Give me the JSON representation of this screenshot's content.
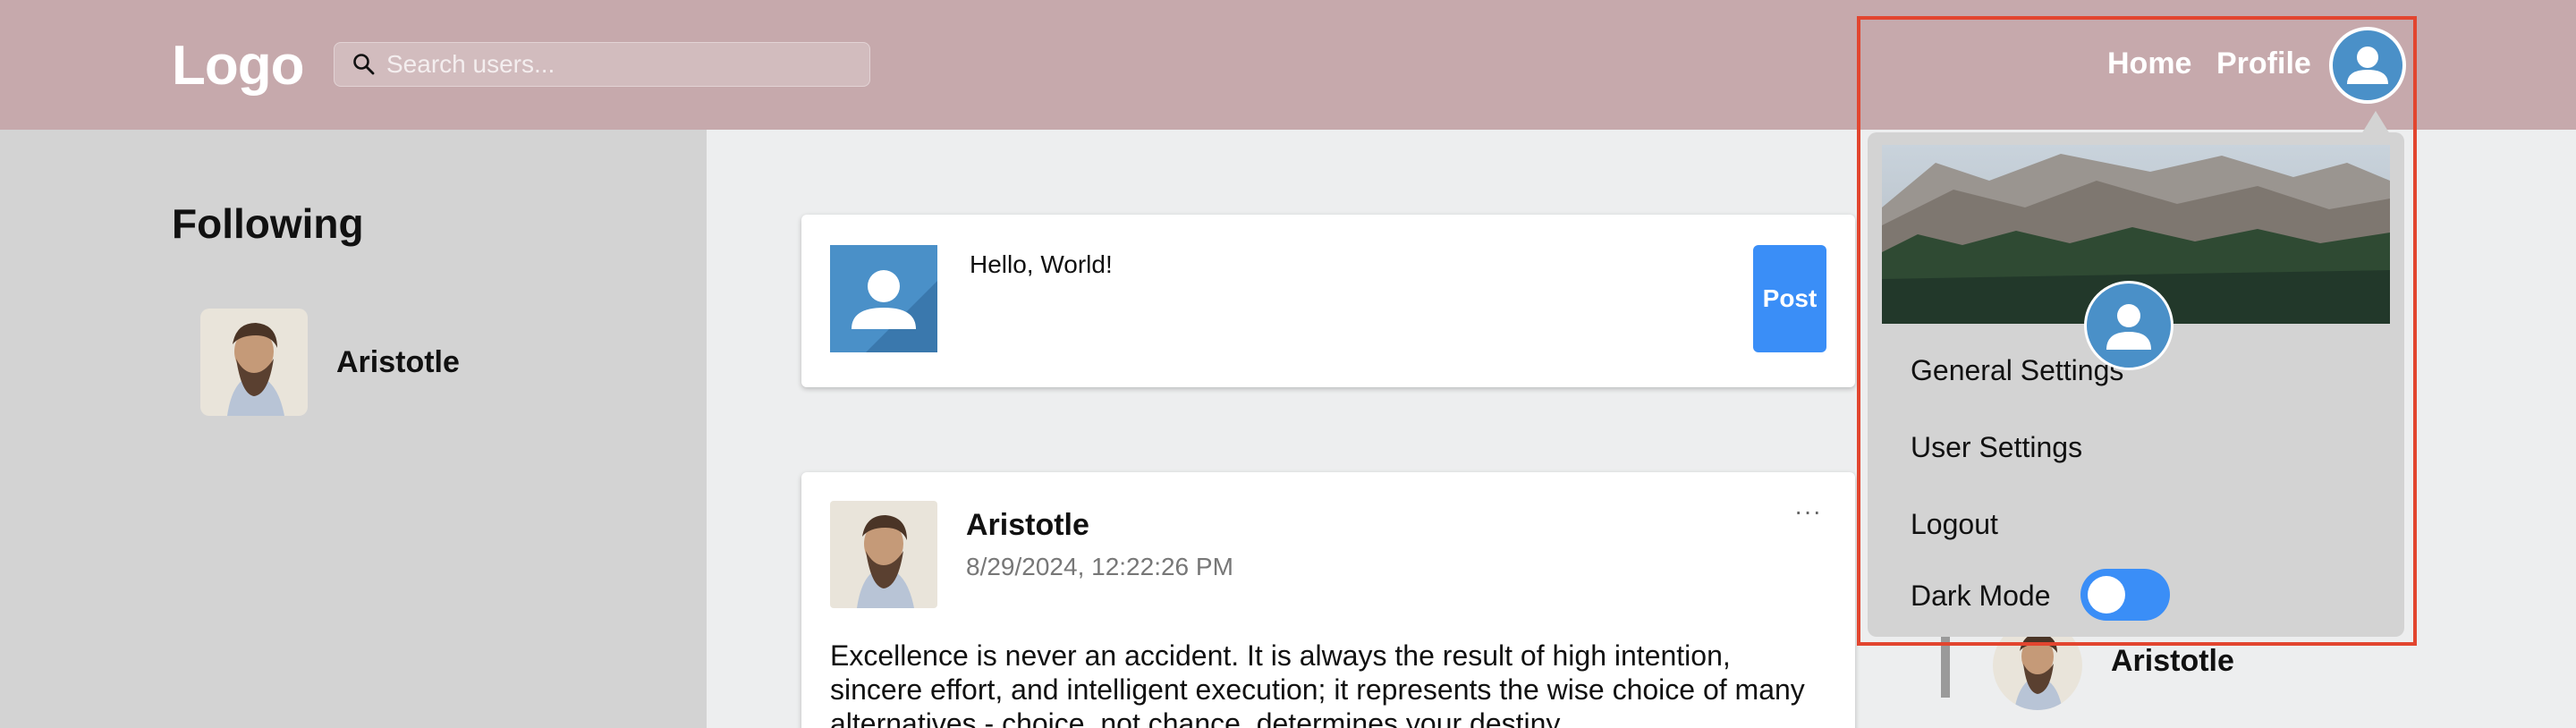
{
  "header": {
    "logo": "Logo",
    "search_placeholder": "Search users...",
    "nav": {
      "home": "Home",
      "profile": "Profile"
    }
  },
  "sidebar": {
    "title": "Following",
    "items": [
      {
        "name": "Aristotle"
      }
    ]
  },
  "composer": {
    "text": "Hello, World!",
    "post_label": "Post"
  },
  "post": {
    "author": "Aristotle",
    "timestamp": "8/29/2024, 12:22:26 PM",
    "menu": "···",
    "body": "Excellence is never an accident. It is always the result of high intention, sincere effort, and intelligent execution; it represents the wise choice of many alternatives - choice, not chance, determines your destiny."
  },
  "right_panel": {
    "name": "Aristotle"
  },
  "dropdown": {
    "items": {
      "general_settings": "General Settings",
      "user_settings": "User Settings",
      "logout": "Logout",
      "dark_mode": "Dark Mode"
    },
    "dark_mode_enabled": false
  },
  "colors": {
    "header_bg": "#c6a9ac",
    "sidebar_bg": "#d3d3d3",
    "accent": "#3a8ef7",
    "avatar_blue": "#4a90c8",
    "highlight": "#e2452f"
  }
}
